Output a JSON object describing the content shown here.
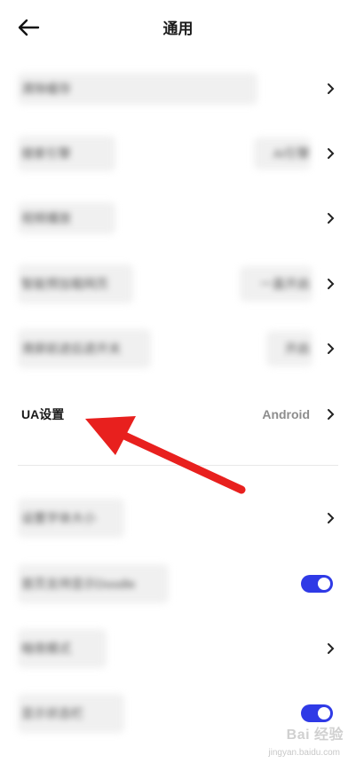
{
  "header": {
    "title": "通用",
    "back_icon": "arrow-left-icon"
  },
  "rows": [
    {
      "label": "清除缓存",
      "value": "",
      "control": "chevron"
    },
    {
      "label": "搜索引擎",
      "value": "AI引擎",
      "control": "chevron"
    },
    {
      "label": "视频播放",
      "value": "",
      "control": "chevron"
    },
    {
      "label": "智能预加载网页",
      "value": "一直开启",
      "control": "chevron"
    },
    {
      "label": "滑屏前进后退开关",
      "value": "开启",
      "control": "chevron"
    },
    {
      "label": "UA设置",
      "value": "Android",
      "control": "chevron"
    },
    {
      "label": "设置字体大小",
      "value": "",
      "control": "chevron"
    },
    {
      "label": "首页支持显示Doodle",
      "value": "",
      "control": "toggle",
      "on": true
    },
    {
      "label": "暗夜模式",
      "value": "",
      "control": "chevron"
    },
    {
      "label": "显示状态栏",
      "value": "",
      "control": "toggle",
      "on": true
    }
  ],
  "colors": {
    "toggle_on": "#2f3ae6",
    "annotation_arrow": "#e8201e"
  },
  "watermark": {
    "text": "Bai 经验",
    "sub": "jingyan.baidu.com"
  }
}
